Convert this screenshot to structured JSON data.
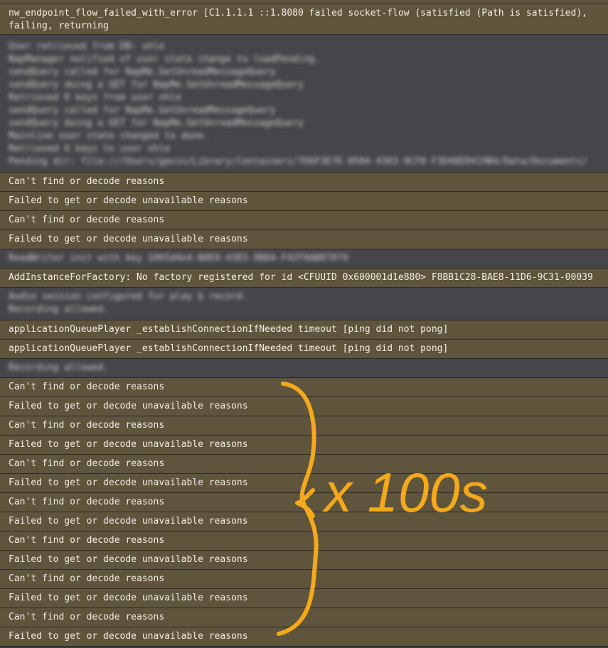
{
  "header_entry": {
    "text_line1": "nw_endpoint_flow_failed_with_error [C1.1.1.1 ::1.8080 failed socket-flow (satisfied (Path is satisfied),",
    "text_line2": "failing, returning"
  },
  "blurred_block_1": [
    "User retrieved from DB: xhle",
    "NapManager notified of user state change to loadPending.",
    "sendQuery called for NapMe.GetUnreadMessageQuery",
    "sendQuery doing a GET for NapMe.GetUnreadMessageQuery",
    "Retrieved 0 keys from user xhle",
    "sendQuery called for NapMe.GetUnreadMessageQuery",
    "sendQuery doing a GET for NapMe.GetUnreadMessageQuery",
    "Mainline user state changed to done.",
    "Retrieved 0 keys to user xhle",
    "Pending dir: file:///Users/gavin/Library/Containers/7D6F3E7E-0504-4303-9CF0-F3D48E0419B4/Data/Documents/"
  ],
  "group_1": [
    "Can't find or decode reasons",
    "Failed to get or decode unavailable reasons",
    "Can't find or decode reasons",
    "Failed to get or decode unavailable reasons"
  ],
  "blurred_line_2": "ReadWriter init with key 1065d4e4-B0E0-4383-9B84-F42F8AB87879",
  "factory_line": "AddInstanceForFactory: No factory registered for id <CFUUID 0x600001d1e880> F8BB1C28-BAE8-11D6-9C31-00039",
  "blurred_block_3": [
    "Audio session configured for play & record.",
    "Recording allowed."
  ],
  "queue_lines": [
    "applicationQueuePlayer _establishConnectionIfNeeded timeout [ping did not pong]",
    "applicationQueuePlayer _establishConnectionIfNeeded timeout [ping did not pong]"
  ],
  "blurred_line_4": "Recording allowed.",
  "group_2": [
    "Can't find or decode reasons",
    "Failed to get or decode unavailable reasons",
    "Can't find or decode reasons",
    "Failed to get or decode unavailable reasons",
    "Can't find or decode reasons",
    "Failed to get or decode unavailable reasons",
    "Can't find or decode reasons",
    "Failed to get or decode unavailable reasons",
    "Can't find or decode reasons",
    "Failed to get or decode unavailable reasons",
    "Can't find or decode reasons",
    "Failed to get or decode unavailable reasons",
    "Can't find or decode reasons",
    "Failed to get or decode unavailable reasons"
  ],
  "annotation": {
    "text": "x 100s",
    "color": "#f4a81c"
  },
  "colors": {
    "warning_row": "#5f543c",
    "info_row": "#46464a",
    "separator": "#2c2c2e"
  }
}
